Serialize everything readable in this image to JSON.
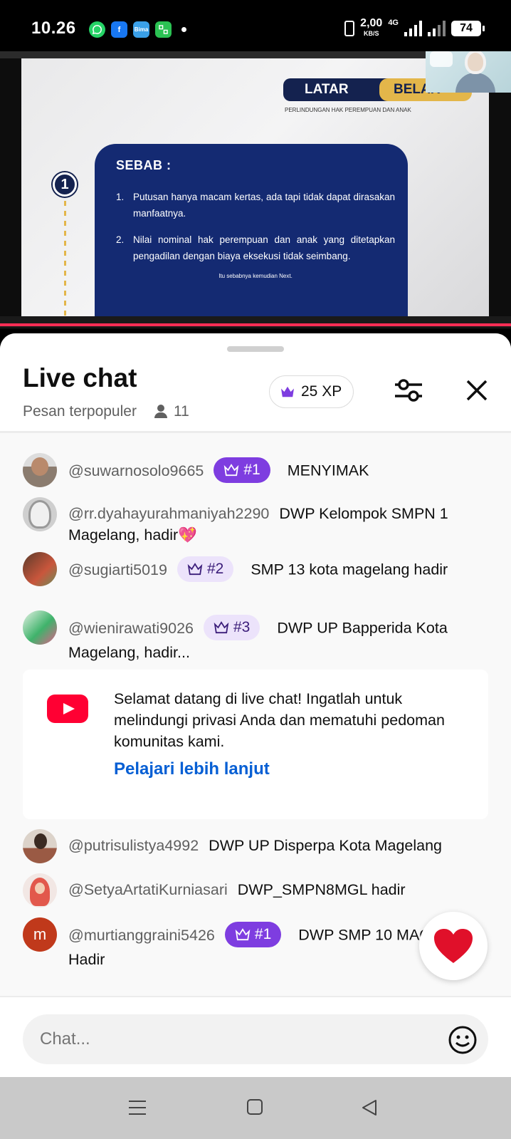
{
  "status_bar": {
    "time": "10.26",
    "net_speed": "2,00",
    "net_speed_unit": "KB/S",
    "network_type": "4G",
    "battery": "74",
    "apps": [
      "whatsapp",
      "facebook",
      "bima",
      "app"
    ],
    "bima_label": "Bima"
  },
  "video": {
    "slide_heading_1": "LATAR",
    "slide_heading_2": "BELAK",
    "slide_subheading": "PERLINDUNGAN HAK PEREMPUAN DAN ANAK",
    "slide_step_number": "1",
    "slide_box_title": "SEBAB :",
    "slide_points": [
      {
        "num": "1.",
        "text": "Putusan hanya macam kertas, ada tapi tidak dapat dirasakan manfaatnya."
      },
      {
        "num": "2.",
        "text": "Nilai nominal hak perempuan dan anak yang ditetapkan pengadilan dengan biaya eksekusi tidak seimbang."
      }
    ],
    "slide_footer": "Itu sebabnya kemudian Next."
  },
  "chat": {
    "title": "Live chat",
    "subtitle": "Pesan terpopuler",
    "viewer_count": "11",
    "xp": "25 XP",
    "messages": [
      {
        "author": "@suwarnosolo9665",
        "rank": "#1",
        "text": "MENYIMAK"
      },
      {
        "author": "@rr.dyahayurahmaniyah2290",
        "rank": "",
        "text": "DWP Kelompok SMPN 1 Magelang, hadir💖"
      },
      {
        "author": "@sugiarti5019",
        "rank": "#2",
        "text": "SMP 13 kota magelang hadir"
      },
      {
        "author": "@wienirawati9026",
        "rank": "#3",
        "text": "DWP UP Bapperida Kota Magelang, hadir..."
      },
      {
        "author": "@putrisulistya4992",
        "rank": "",
        "text": "DWP UP Disperpa Kota Magelang"
      },
      {
        "author": "@SetyaArtatiKurniasari",
        "rank": "",
        "text": "DWP_SMPN8MGL hadir"
      },
      {
        "author": "@murtianggraini5426",
        "rank": "#1",
        "text": "DWP SMP 10 MAGELANG, Hadir"
      }
    ],
    "avatar_letter": "m",
    "welcome": {
      "text": "Selamat datang di live chat! Ingatlah untuk melindungi privasi Anda dan mematuhi pedoman komunitas kami.",
      "link": "Pelajari lebih lanjut"
    },
    "input_placeholder": "Chat...",
    "accent_color": "#7e3de0",
    "link_color": "#065fd4"
  }
}
